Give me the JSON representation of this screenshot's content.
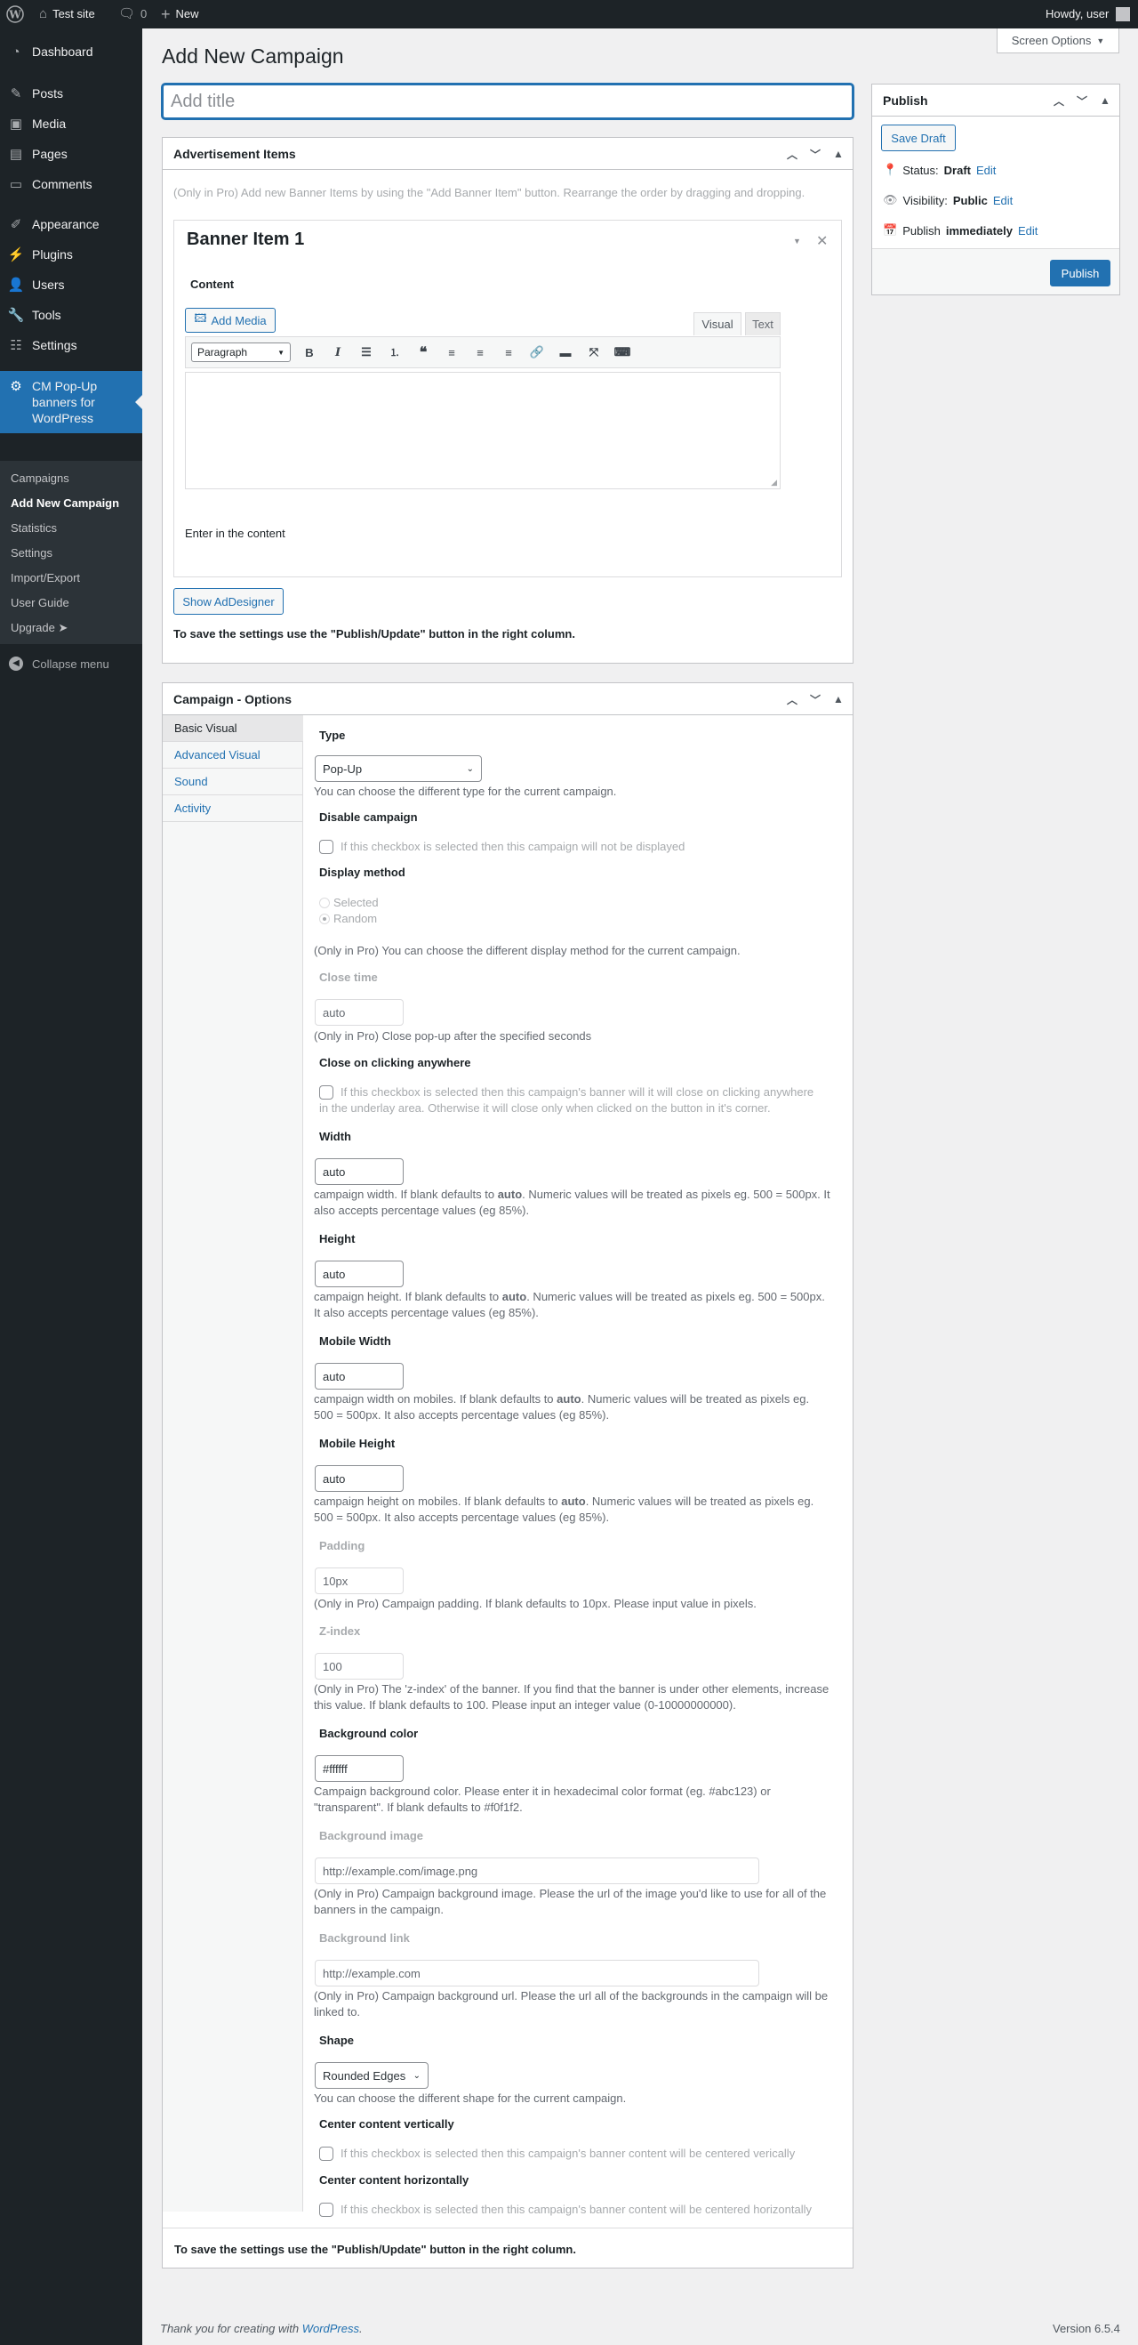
{
  "adminbar": {
    "site_name": "Test site",
    "comments_count": "0",
    "new_label": "New",
    "howdy": "Howdy, user"
  },
  "sidebar": {
    "items": [
      {
        "label": "Dashboard",
        "icon": "dashboard-icon"
      },
      {
        "label": "Posts",
        "icon": "pin-icon"
      },
      {
        "label": "Media",
        "icon": "media-icon"
      },
      {
        "label": "Pages",
        "icon": "pages-icon"
      },
      {
        "label": "Comments",
        "icon": "comment-icon"
      },
      {
        "label": "Appearance",
        "icon": "brush-icon"
      },
      {
        "label": "Plugins",
        "icon": "plugin-icon"
      },
      {
        "label": "Users",
        "icon": "user-icon"
      },
      {
        "label": "Tools",
        "icon": "wrench-icon"
      },
      {
        "label": "Settings",
        "icon": "settings-icon"
      }
    ],
    "current": {
      "label": "CM Pop-Up banners for WordPress",
      "icon": "gear-icon"
    },
    "submenu": [
      "Campaigns",
      "Add New Campaign",
      "Statistics",
      "Settings",
      "Import/Export",
      "User Guide",
      "Upgrade ➤"
    ],
    "collapse": "Collapse menu"
  },
  "header": {
    "title": "Add New Campaign",
    "screen_options": "Screen Options"
  },
  "title_placeholder": "Add title",
  "ad_items": {
    "heading": "Advertisement Items",
    "note": "(Only in Pro) Add new Banner Items by using the \"Add Banner Item\" button. Rearrange the order by dragging and dropping.",
    "banner_title": "Banner Item 1",
    "content_label": "Content",
    "add_media": "Add Media",
    "tab_visual": "Visual",
    "tab_text": "Text",
    "format": "Paragraph",
    "enter_content": "Enter in the content",
    "show_designer": "Show AdDesigner",
    "save_note": "To save the settings use the \"Publish/Update\" button in the right column."
  },
  "publish": {
    "heading": "Publish",
    "save_draft": "Save Draft",
    "status_label": "Status:",
    "status_value": "Draft",
    "visibility_label": "Visibility:",
    "visibility_value": "Public",
    "publish_label": "Publish",
    "publish_value": "immediately",
    "edit": "Edit",
    "publish_button": "Publish"
  },
  "options": {
    "heading": "Campaign - Options",
    "tabs": [
      "Basic Visual",
      "Advanced Visual",
      "Sound",
      "Activity"
    ],
    "type": {
      "label": "Type",
      "value": "Pop-Up",
      "desc": "You can choose the different type for the current campaign."
    },
    "disable": {
      "label": "Disable campaign",
      "desc": "If this checkbox is selected then this campaign will not be displayed"
    },
    "display": {
      "label": "Display method",
      "opt1": "Selected",
      "opt2": "Random",
      "desc": "(Only in Pro) You can choose the different display method for the current campaign."
    },
    "close_time": {
      "label": "Close time",
      "value": "auto",
      "desc": "(Only in Pro) Close pop-up after the specified seconds"
    },
    "close_anywhere": {
      "label": "Close on clicking anywhere",
      "desc1": "If this checkbox is selected then this campaign's banner will it will close on clicking anywhere",
      "desc2": "in the underlay area. Otherwise it will close only when clicked on the button in it's corner."
    },
    "width": {
      "label": "Width",
      "value": "auto",
      "desc_pre": "campaign width. If blank defaults to ",
      "desc_bold": "auto",
      "desc_post": ". Numeric values will be treated as pixels eg. 500 = 500px. It",
      "desc2": "also accepts percentage values (eg 85%)."
    },
    "height": {
      "label": "Height",
      "value": "auto",
      "desc_pre": "campaign height. If blank defaults to ",
      "desc_bold": "auto",
      "desc_post": ". Numeric values will be treated as pixels eg. 500 = 500px.",
      "desc2": "It also accepts percentage values (eg 85%)."
    },
    "mwidth": {
      "label": "Mobile Width",
      "value": "auto",
      "desc_pre": "campaign width on mobiles. If blank defaults to ",
      "desc_bold": "auto",
      "desc_post": ". Numeric values will be treated as pixels eg.",
      "desc2": "500 = 500px. It also accepts percentage values (eg 85%)."
    },
    "mheight": {
      "label": "Mobile Height",
      "value": "auto",
      "desc_pre": "campaign height on mobiles. If blank defaults to ",
      "desc_bold": "auto",
      "desc_post": ". Numeric values will be treated as pixels eg.",
      "desc2": "500 = 500px. It also accepts percentage values (eg 85%)."
    },
    "padding": {
      "label": "Padding",
      "value": "10px",
      "desc": "(Only in Pro) Campaign padding. If blank defaults to 10px. Please input value in pixels."
    },
    "zindex": {
      "label": "Z-index",
      "value": "100",
      "desc1": "(Only in Pro) The 'z-index' of the banner. If you find that the banner is under other elements, increase",
      "desc2": "this value. If blank defaults to 100. Please input an integer value (0-10000000000)."
    },
    "bgcolor": {
      "label": "Background color",
      "value": "#ffffff",
      "desc1": "Campaign background color. Please enter it in hexadecimal color format (eg. #abc123) or",
      "desc2": "\"transparent\". If blank defaults to #f0f1f2."
    },
    "bgimage": {
      "label": "Background image",
      "value": "http://example.com/image.png",
      "desc1": "(Only in Pro) Campaign background image. Please the url of the image you'd like to use for all of the",
      "desc2": "banners in the campaign."
    },
    "bglink": {
      "label": "Background link",
      "value": "http://example.com",
      "desc1": "(Only in Pro) Campaign background url. Please the url all of the backgrounds in the campaign will be",
      "desc2": "linked to."
    },
    "shape": {
      "label": "Shape",
      "value": "Rounded Edges",
      "desc": "You can choose the different shape for the current campaign."
    },
    "center_v": {
      "label": "Center content vertically",
      "desc": "If this checkbox is selected then this campaign's banner content will be centered verically"
    },
    "center_h": {
      "label": "Center content horizontally",
      "desc": "If this checkbox is selected then this campaign's banner content will be centered horizontally"
    },
    "save_note": "To save the settings use the \"Publish/Update\" button in the right column."
  },
  "footer": {
    "thanks_pre": "Thank you for creating with ",
    "thanks_link": "WordPress",
    "thanks_post": ".",
    "version": "Version 6.5.4"
  }
}
